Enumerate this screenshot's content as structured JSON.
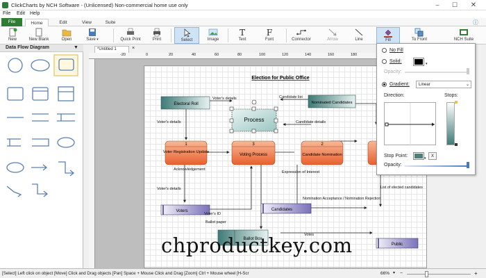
{
  "window": {
    "title": "ClickCharts by NCH Software - (Unlicensed) Non-commercial home use only"
  },
  "menu": [
    "File",
    "Edit",
    "Help"
  ],
  "tabs": [
    "File",
    "Home",
    "Edit",
    "View",
    "Suite"
  ],
  "ribbon": {
    "new": "New",
    "new_blank": "New Blank",
    "open": "Open",
    "save": "Save",
    "quick_print": "Quick Print",
    "print": "Print",
    "select": "Select",
    "image": "Image",
    "text": "Text",
    "font": "Font",
    "connector": "Connector",
    "arrow": "Arrow",
    "line": "Line",
    "fill": "Fill",
    "to_front": "To Front",
    "nch_suite": "NCH Suite"
  },
  "left_panel": {
    "title": "Data Flow Diagram"
  },
  "document_tab": "*Untitled 1",
  "ruler": [
    "-20",
    "0",
    "20",
    "40",
    "60",
    "80",
    "100",
    "120",
    "140",
    "160",
    "180"
  ],
  "diagram": {
    "title": "Election for Public Office",
    "electoral_roll": "Electoral Roll",
    "nominated_candidates": "Nominated Candidates",
    "process": "Process",
    "p1_num": "1",
    "p1": "Voter Registration Update",
    "p3_num": "3",
    "p3": "Voting Process",
    "p2_num": "2",
    "p2": "Candidate Nomination",
    "voters": "Voters",
    "candidates": "Candidates",
    "ballot_box": "Ballot Box",
    "public": "Public",
    "lbl_voters_details_top": "Voter's details",
    "lbl_candidate_list": "Candidate list",
    "lbl_voters_details_left": "Voter's details",
    "lbl_candidate_details": "Candidate details",
    "lbl_acknowledgement": "Acknowledgement",
    "lbl_expression": "Expression of Interest",
    "lbl_voters_details_low": "Voter's details",
    "lbl_nomination": "Nomination Acceptance / Nomination Rejection",
    "lbl_list_elected": "List of elected candidates",
    "lbl_voters_id": "Voter's ID",
    "lbl_ballot_paper": "Ballot paper",
    "lbl_votes": "Votes"
  },
  "fill_panel": {
    "no_fill": "No Fill",
    "solid": "Solid:",
    "opacity": "Opacity:",
    "gradient": "Gradient:",
    "gradient_type": "Linear",
    "direction": "Direction:",
    "stops": "Stops:",
    "stop_point": "Stop Point:",
    "opacity2": "Opacity:",
    "stop_remove": "X",
    "solid_color": "#000000",
    "stop_color": "#4a7f7a"
  },
  "status": {
    "hint": "[Select] Left click on object [Move] Click and Drag objects [Pan] Space + Mouse Click and Drag [Zoom] Ctrl + Mouse wheel [H-Scr",
    "zoom": "66%"
  },
  "watermark": "chproductkey.com"
}
